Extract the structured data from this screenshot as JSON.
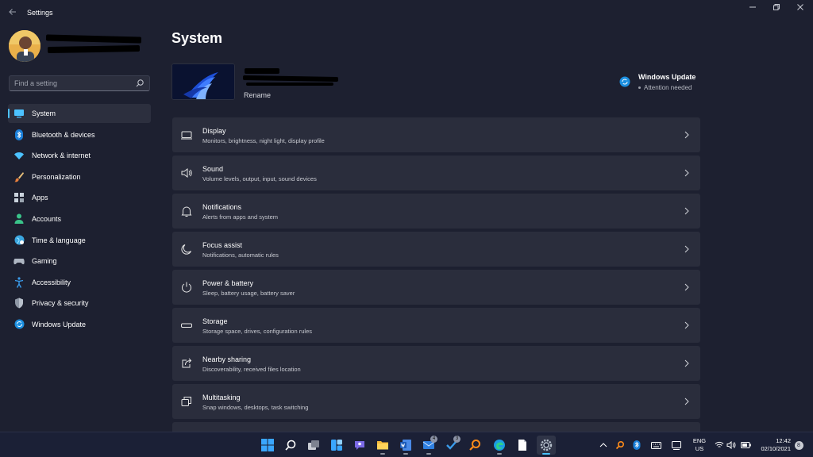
{
  "window": {
    "title": "Settings",
    "controls": [
      "minimize-icon",
      "restore-icon",
      "close-icon"
    ]
  },
  "sidebar": {
    "search": {
      "placeholder": "Find a setting",
      "value": ""
    },
    "items": [
      {
        "label": "System",
        "icon": "system-icon",
        "active": true
      },
      {
        "label": "Bluetooth & devices",
        "icon": "bluetooth-icon"
      },
      {
        "label": "Network & internet",
        "icon": "wifi-icon"
      },
      {
        "label": "Personalization",
        "icon": "brush-icon"
      },
      {
        "label": "Apps",
        "icon": "apps-icon"
      },
      {
        "label": "Accounts",
        "icon": "accounts-icon"
      },
      {
        "label": "Time & language",
        "icon": "globe-icon"
      },
      {
        "label": "Gaming",
        "icon": "gamepad-icon"
      },
      {
        "label": "Accessibility",
        "icon": "accessibility-icon"
      },
      {
        "label": "Privacy & security",
        "icon": "shield-icon"
      },
      {
        "label": "Windows Update",
        "icon": "update-icon"
      }
    ]
  },
  "main": {
    "title": "System",
    "device": {
      "rename": "Rename"
    },
    "windows_update": {
      "title": "Windows Update",
      "status": "Attention needed"
    },
    "cards": [
      {
        "title": "Display",
        "subtitle": "Monitors, brightness, night light, display profile",
        "icon": "display-icon"
      },
      {
        "title": "Sound",
        "subtitle": "Volume levels, output, input, sound devices",
        "icon": "speaker-icon"
      },
      {
        "title": "Notifications",
        "subtitle": "Alerts from apps and system",
        "icon": "bell-icon"
      },
      {
        "title": "Focus assist",
        "subtitle": "Notifications, automatic rules",
        "icon": "moon-icon"
      },
      {
        "title": "Power & battery",
        "subtitle": "Sleep, battery usage, battery saver",
        "icon": "power-icon"
      },
      {
        "title": "Storage",
        "subtitle": "Storage space, drives, configuration rules",
        "icon": "storage-icon"
      },
      {
        "title": "Nearby sharing",
        "subtitle": "Discoverability, received files location",
        "icon": "share-icon"
      },
      {
        "title": "Multitasking",
        "subtitle": "Snap windows, desktops, task switching",
        "icon": "multitask-icon"
      }
    ]
  },
  "taskbar": {
    "apps": [
      {
        "name": "start-icon"
      },
      {
        "name": "search-icon"
      },
      {
        "name": "task-view-icon"
      },
      {
        "name": "widgets-icon"
      },
      {
        "name": "chat-icon"
      },
      {
        "name": "file-explorer-icon",
        "open": true
      },
      {
        "name": "word-icon",
        "open": true
      },
      {
        "name": "mail-icon",
        "badge": "4",
        "open": true
      },
      {
        "name": "todo-icon",
        "badge": "3"
      },
      {
        "name": "search-app-icon"
      },
      {
        "name": "edge-icon",
        "open": true
      },
      {
        "name": "notepad-icon"
      },
      {
        "name": "settings-icon",
        "open": true,
        "active": true
      }
    ],
    "tray": {
      "language": "ENG",
      "region": "US",
      "time": "12:42",
      "date": "02/10/2021",
      "notification_count": "8"
    }
  },
  "colors": {
    "accent": "#4cc2ff",
    "background": "#1d2030",
    "card": "#2a2d3c"
  }
}
